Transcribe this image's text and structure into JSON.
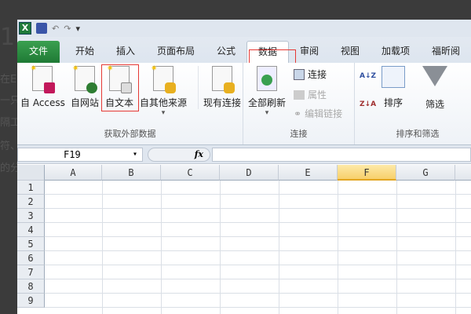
{
  "background_text": [
    "1",
    "在E",
    "一只",
    "隔工",
    "符、",
    "的分"
  ],
  "qat": {
    "logo": "X",
    "undo": "↶",
    "redo": "↷",
    "customize": "▾"
  },
  "tabs": [
    {
      "label": "文件"
    },
    {
      "label": "开始"
    },
    {
      "label": "插入"
    },
    {
      "label": "页面布局"
    },
    {
      "label": "公式"
    },
    {
      "label": "数据"
    },
    {
      "label": "审阅"
    },
    {
      "label": "视图"
    },
    {
      "label": "加载项"
    },
    {
      "label": "福昕阅"
    }
  ],
  "active_tab": "数据",
  "ribbon": {
    "get_external": {
      "label": "获取外部数据",
      "buttons": [
        "自 Access",
        "自网站",
        "自文本",
        "自其他来源",
        "现有连接"
      ],
      "dropdown": "▾"
    },
    "connections": {
      "label": "连接",
      "refresh_all": "全部刷新",
      "dropdown": "▾",
      "connections": "连接",
      "properties": "属性",
      "edit_links": "编辑链接"
    },
    "sort_filter": {
      "label": "排序和筛选",
      "sort_asc": "A↓Z",
      "sort_desc": "Z↓A",
      "sort": "排序",
      "filter": "筛选"
    }
  },
  "formula_bar": {
    "name_box": "F19",
    "dropdown": "▾",
    "fx": "fx",
    "value": ""
  },
  "columns": [
    "A",
    "B",
    "C",
    "D",
    "E",
    "F",
    "G"
  ],
  "selected_column": "F",
  "rows": [
    "1",
    "2",
    "3",
    "4",
    "5",
    "6",
    "7",
    "8",
    "9"
  ],
  "colors": {
    "file_tab": "#2a8a42",
    "highlight": "#e53935",
    "selected_header": "#f7d06a"
  }
}
